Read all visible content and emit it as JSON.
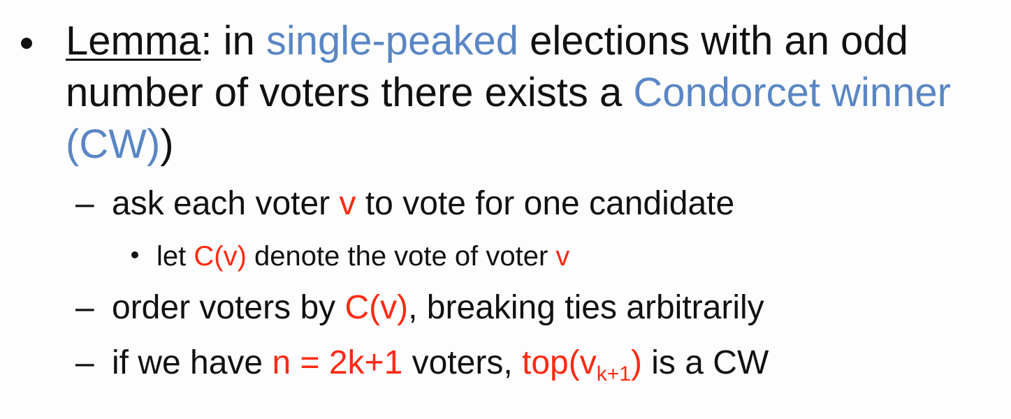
{
  "lemma": {
    "label": "Lemma",
    "colon": ": in ",
    "single_peaked": "single-peaked",
    "mid1": " elections with an odd number of voters there exists a ",
    "condorcet_winner": "Condorcet winner (CW)",
    "close_paren": ")"
  },
  "items": [
    {
      "dash": "–",
      "part1": "ask each voter ",
      "v": "v",
      "part2": " to vote for one candidate"
    },
    {
      "dash": "–",
      "part1": "order voters by ",
      "cv": "C(v)",
      "part2": ", breaking ties arbitrarily"
    },
    {
      "dash": "–",
      "part1": "if we have ",
      "n_eq": "n = 2k+1",
      "part2": " voters, ",
      "top_pre": "top(v",
      "top_sub": "k+1",
      "top_post": ")",
      "part3": " is a CW"
    }
  ],
  "subitem": {
    "part1": "let ",
    "cv": "C(v)",
    "part2": " denote the vote of voter ",
    "v": "v"
  },
  "colors": {
    "blue": "#5a86c4",
    "red": "#ff2a14",
    "text": "#111111",
    "background": "#fdfdfd"
  }
}
